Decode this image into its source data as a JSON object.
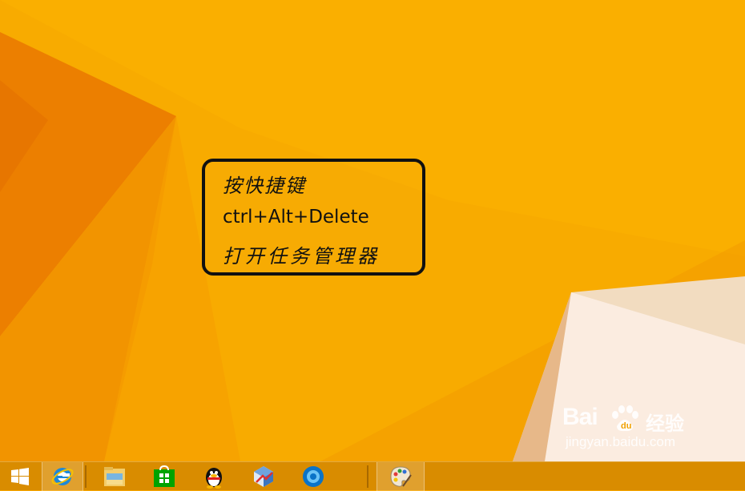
{
  "wallpaper": {
    "base_color": "#f7a600",
    "accent_light": "#fbe9cf"
  },
  "note": {
    "line1": "按快捷键",
    "line2": "ctrl+Alt+Delete",
    "line3": "打开任务管理器"
  },
  "watermark": {
    "logo_text": "Bai",
    "logo_cn": "经验",
    "url": "jingyan.baidu.com"
  },
  "taskbar": {
    "color": "#d68a00",
    "icons": [
      "windows-start-icon",
      "internet-explorer-icon",
      "file-explorer-icon",
      "windows-store-icon",
      "qq-penguin-icon",
      "app-icon",
      "blue-circle-app-icon",
      "paint-icon"
    ]
  }
}
